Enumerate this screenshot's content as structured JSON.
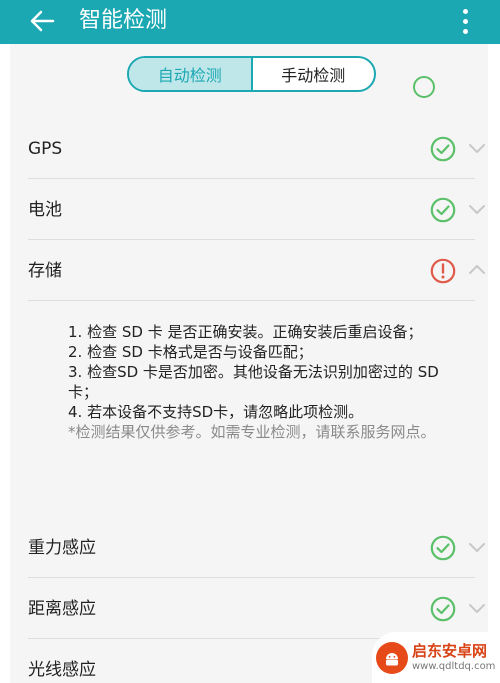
{
  "app_bar": {
    "title": "智能检测"
  },
  "segmented": {
    "auto_label": "自动检测",
    "manual_label": "手动检测",
    "selected": "自动检测"
  },
  "rows": [
    {
      "label": "GPS",
      "status": "pass",
      "status_icon": "check-circle-icon"
    },
    {
      "label": "电池",
      "status": "pass",
      "status_icon": "check-circle-icon"
    },
    {
      "label": "存储",
      "status": "warning",
      "status_icon": "exclamation-circle-icon",
      "expanded": true
    },
    {
      "label": "重力感应",
      "status": "pass",
      "status_icon": "check-circle-icon"
    },
    {
      "label": "距离感应",
      "status": "pass",
      "status_icon": "check-circle-icon"
    },
    {
      "label": "光线感应"
    }
  ],
  "storage_details": {
    "items": [
      "1. 检查 SD 卡 是否正确安装。正确安装后重启设备；",
      "2. 检查 SD 卡格式是否与设备匹配；",
      "3. 检查SD 卡是否加密。其他设备无法识别加密过的 SD 卡；",
      "4. 若本设备不支持SD卡，请忽略此项检测。"
    ],
    "note": "*检测结果仅供参考。如需专业检测，请联系服务网点。"
  },
  "watermark": {
    "name": "启东安卓网",
    "url": "www.qdltdq.com"
  },
  "colors": {
    "accent": "#1ba8b3",
    "pass": "#5cc06a",
    "warning": "#e05a4a",
    "chevron": "#c8c8c8"
  }
}
